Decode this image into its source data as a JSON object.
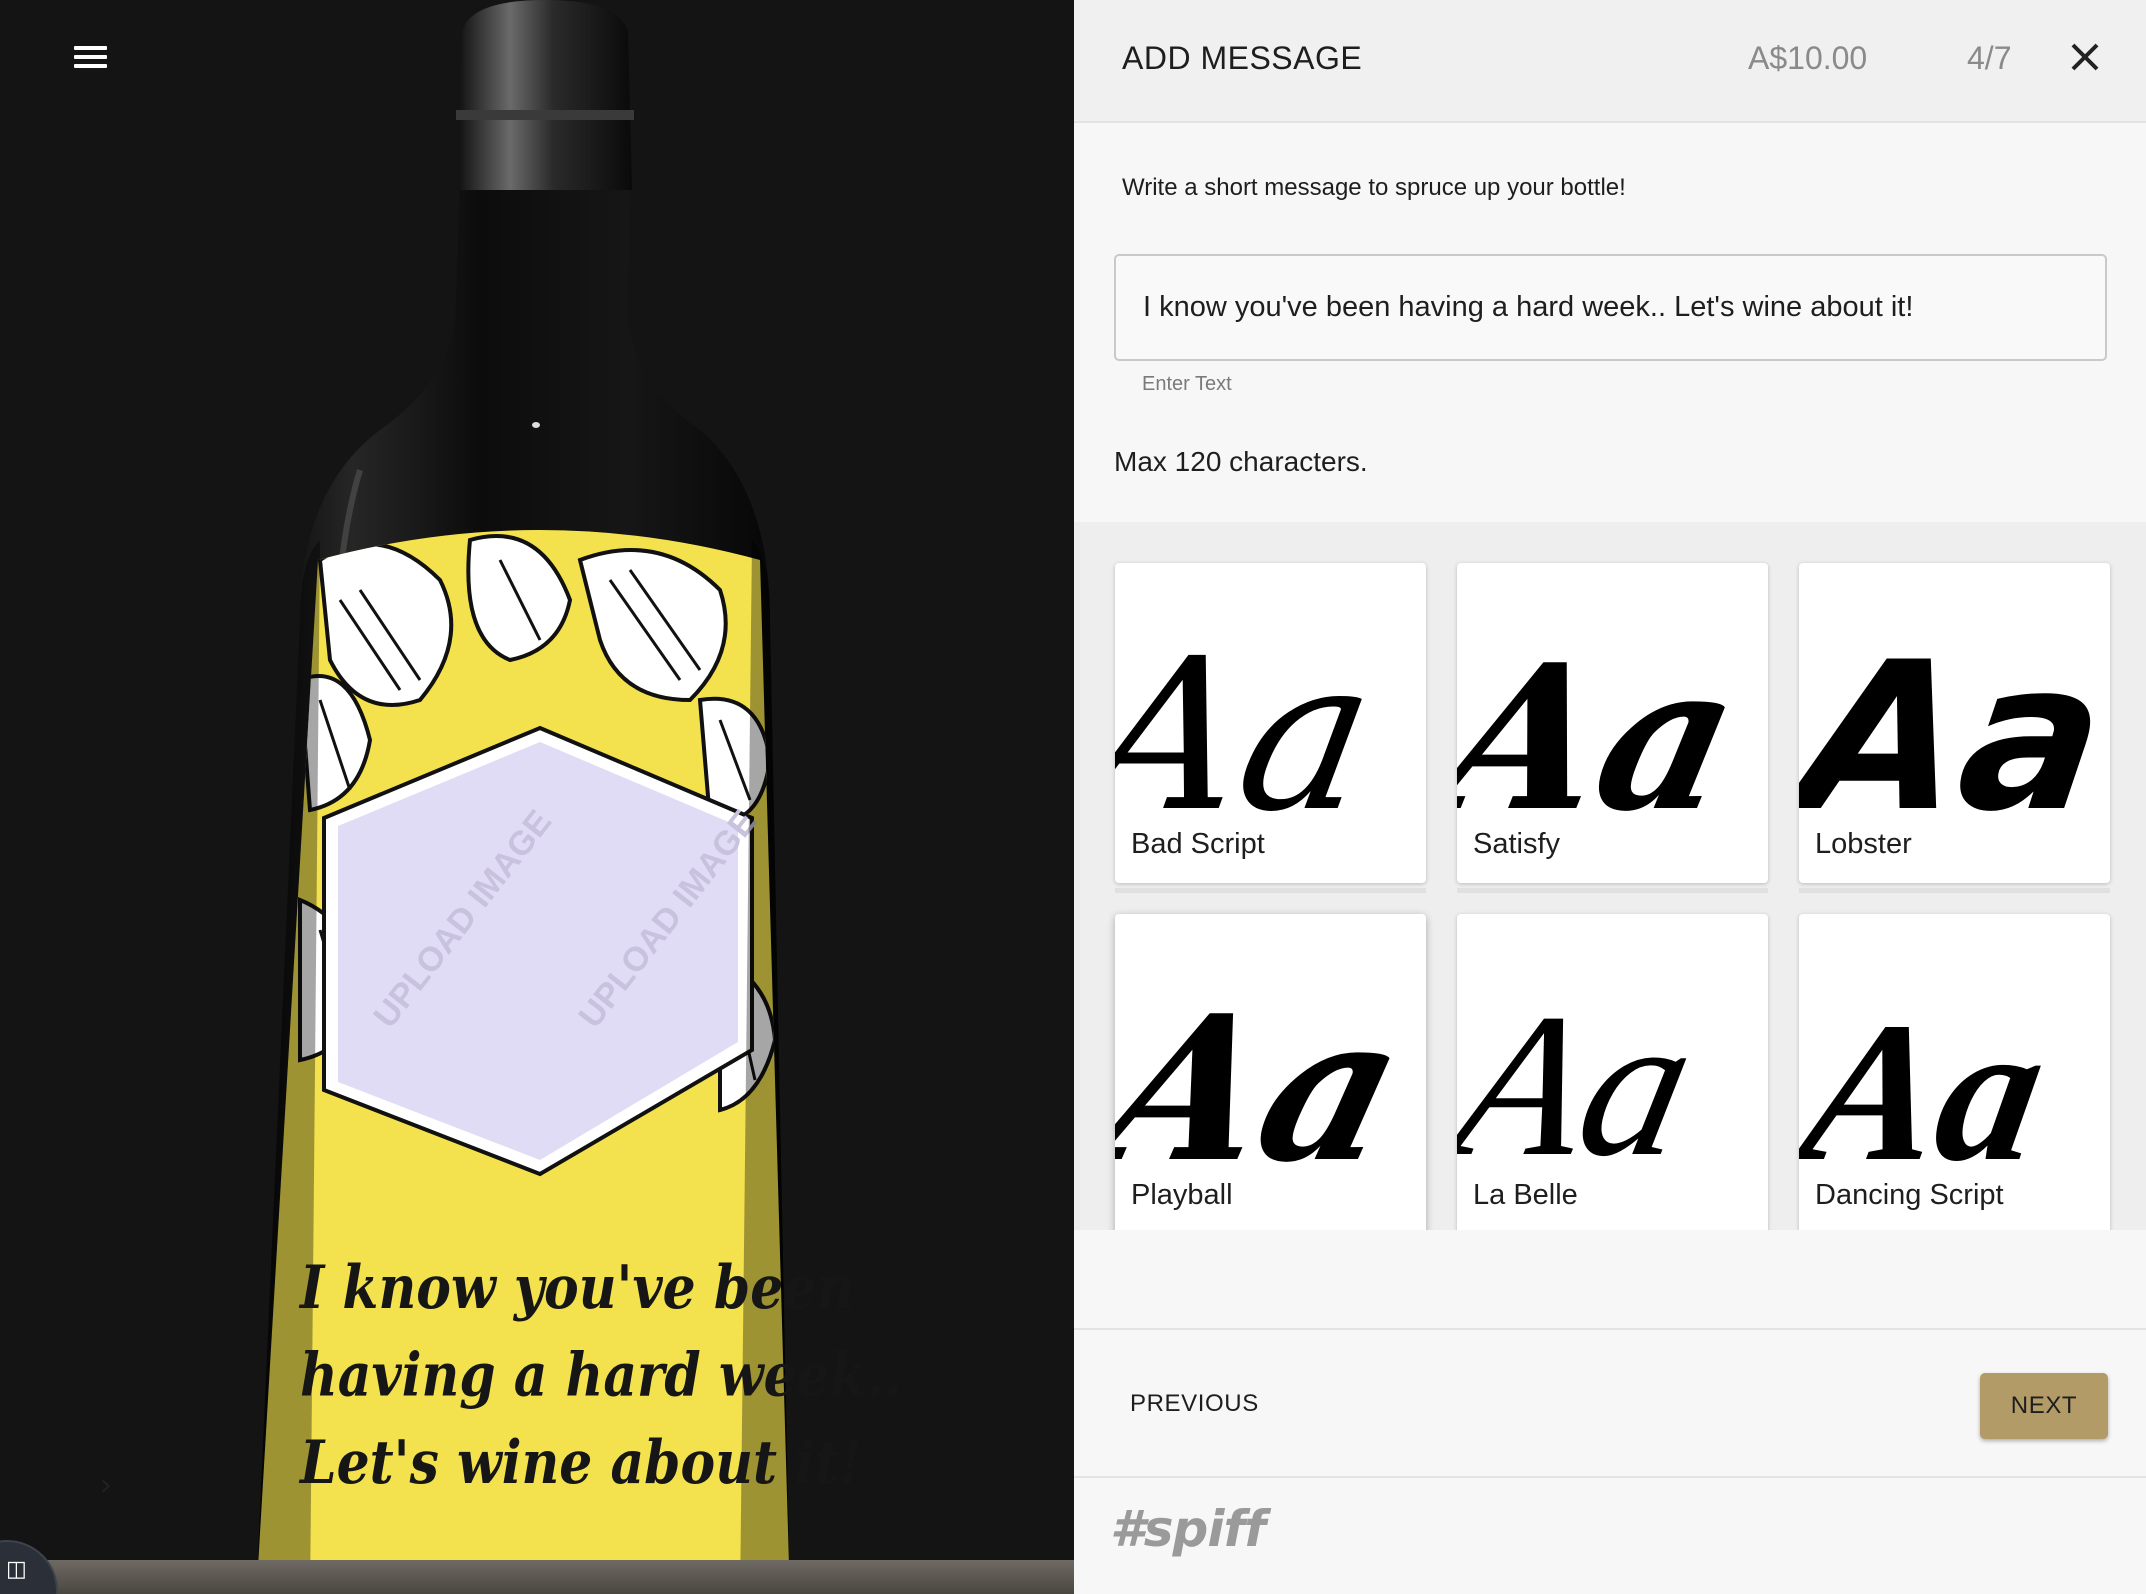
{
  "stage": {
    "bottle_message_lines": [
      "I know you've been",
      "having a hard week..",
      "Let's wine about it!"
    ],
    "upload_placeholder": "UPLOAD IMAGE",
    "next_arrow": "›"
  },
  "panel": {
    "title": "ADD MESSAGE",
    "price": "A$10.00",
    "step": "4/7",
    "intro": "Write a short message to spruce up your bottle!",
    "input_value": "I know you've been having a hard week.. Let's wine about it!",
    "input_helper": "Enter Text",
    "max_chars": "Max 120 characters.",
    "sample_text": "Aa",
    "fonts": [
      {
        "name": "Bad Script"
      },
      {
        "name": "Satisfy"
      },
      {
        "name": "Lobster"
      },
      {
        "name": "Playball"
      },
      {
        "name": "La Belle"
      },
      {
        "name": "Dancing Script"
      }
    ],
    "previous_label": "PREVIOUS",
    "next_label": "NEXT",
    "brand": "#spiff"
  },
  "colors": {
    "accent": "#b39b67",
    "label_yellow": "#f3e24d",
    "panel_bg": "#f7f7f7",
    "stage_bg": "#141414"
  }
}
